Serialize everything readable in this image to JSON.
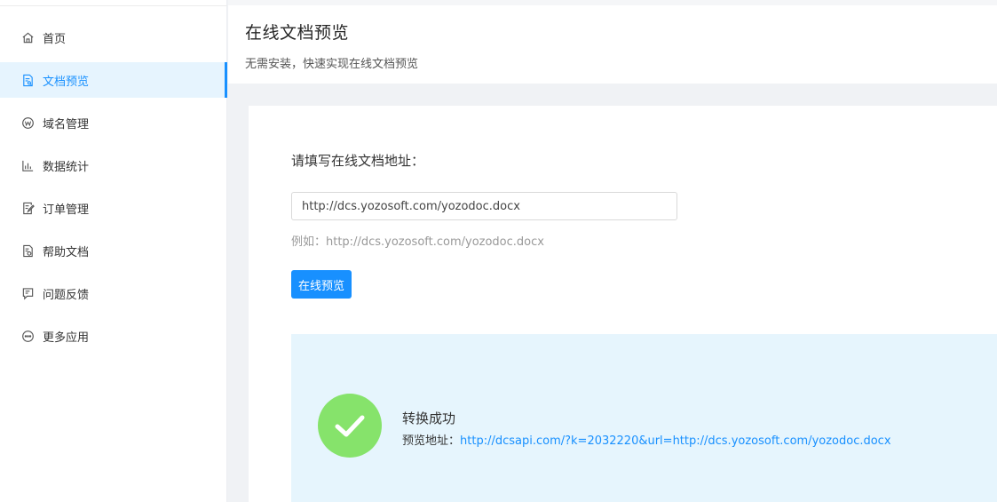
{
  "sidebar": {
    "items": [
      {
        "label": "首页",
        "icon": "home-icon",
        "active": false
      },
      {
        "label": "文档预览",
        "icon": "document-preview-icon",
        "active": true
      },
      {
        "label": "域名管理",
        "icon": "domain-icon",
        "active": false
      },
      {
        "label": "数据统计",
        "icon": "bar-chart-icon",
        "active": false
      },
      {
        "label": "订单管理",
        "icon": "order-edit-icon",
        "active": false
      },
      {
        "label": "帮助文档",
        "icon": "help-document-icon",
        "active": false
      },
      {
        "label": "问题反馈",
        "icon": "feedback-icon",
        "active": false
      },
      {
        "label": "更多应用",
        "icon": "more-icon",
        "active": false
      }
    ]
  },
  "header": {
    "title": "在线文档预览",
    "subtitle": "无需安装，快速实现在线文档预览"
  },
  "form": {
    "label": "请填写在线文档地址：",
    "input_value": "http://dcs.yozosoft.com/yozodoc.docx",
    "hint": "例如：http://dcs.yozosoft.com/yozodoc.docx",
    "button_label": "在线预览"
  },
  "result": {
    "title": "转换成功",
    "address_label": "预览地址：",
    "address_url": "http://dcsapi.com/?k=2032220&url=http://dcs.yozosoft.com/yozodoc.docx"
  },
  "colors": {
    "accent": "#1890ff",
    "active_bg": "#e6f4fe",
    "success": "#86e36b",
    "result_bg": "#e6f5fd"
  }
}
